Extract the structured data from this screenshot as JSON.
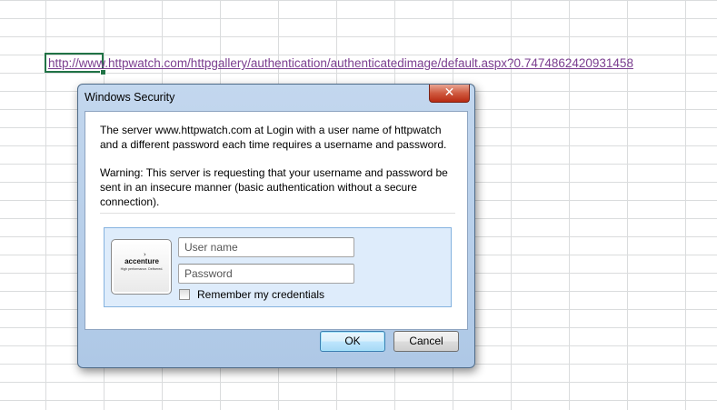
{
  "sheet": {
    "cell_link": "http://www.httpwatch.com/httpgallery/authentication/authenticatedimage/default.aspx?0.7474862420931458",
    "link_color": "#7a3d8f",
    "active_cell_border_color": "#217346"
  },
  "dialog": {
    "title": "Windows Security",
    "close_icon": "close-icon",
    "message_line1": "The server www.httpwatch.com at Login with a user name of httpwatch and a different password each time requires a username and password.",
    "warning": "Warning: This server is requesting that your username and password be sent in an insecure manner (basic authentication without a secure connection).",
    "tile": {
      "logo_icon": "accenture-logo-icon",
      "logo_text": "accenture",
      "logo_tagline": "High performance. Delivered."
    },
    "username": {
      "value": "",
      "placeholder": "User name"
    },
    "password": {
      "value": "",
      "placeholder": "Password"
    },
    "remember": {
      "label": "Remember my credentials",
      "checked": false
    },
    "buttons": {
      "ok": "OK",
      "cancel": "Cancel"
    },
    "colors": {
      "frame": "#aec8e6",
      "close_button": "#cf5a40",
      "credential_tile": "#deecfb",
      "ok_button": "#bee6fd"
    }
  }
}
